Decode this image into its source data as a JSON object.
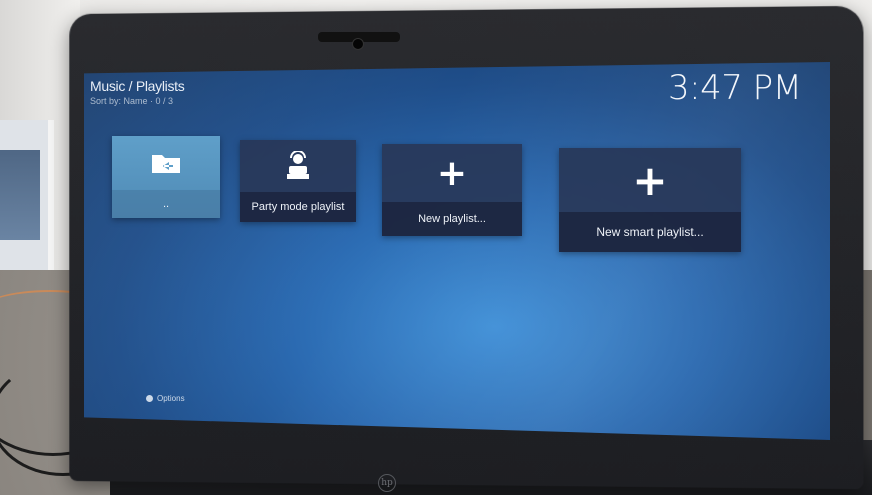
{
  "header": {
    "breadcrumb": "Music / Playlists",
    "sort_info": "Sort by: Name · 0 / 3",
    "clock": "3:47 PM"
  },
  "tiles": [
    {
      "label": "..",
      "icon": "back-folder-icon",
      "selected": true
    },
    {
      "label": "Party mode playlist",
      "icon": "dj-icon",
      "selected": false
    },
    {
      "label": "New playlist...",
      "icon": "plus-icon",
      "selected": false
    },
    {
      "label": "New smart playlist...",
      "icon": "plus-icon",
      "selected": false
    }
  ],
  "footer": {
    "options_label": "Options"
  },
  "device": {
    "brand_mark": "hp"
  },
  "colors": {
    "screen_bg": "#2b6ab1",
    "tile_bg": "#28375a",
    "tile_selected": "#5f9fc9"
  }
}
